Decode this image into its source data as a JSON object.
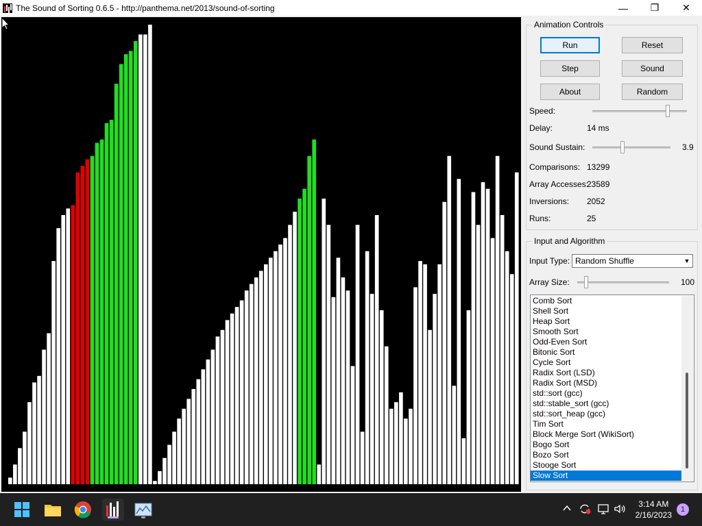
{
  "window": {
    "title": "The Sound of Sorting 0.6.5 - http://panthema.net/2013/sound-of-sorting",
    "minimize_label": "—",
    "maximize_label": "❐",
    "close_label": "✕"
  },
  "visualization": {
    "bar_values": [
      2,
      6,
      11,
      16,
      25,
      31,
      33,
      41,
      46,
      68,
      78,
      82,
      84,
      85,
      95,
      97,
      99,
      100,
      104,
      105,
      110,
      111,
      122,
      128,
      131,
      132,
      135,
      137,
      137,
      140,
      1,
      4,
      8,
      12,
      16,
      20,
      23,
      26,
      29,
      32,
      35,
      38,
      41,
      45,
      47,
      50,
      52,
      54,
      56,
      59,
      61,
      63,
      65,
      67,
      69,
      71,
      73,
      75,
      79,
      83,
      87,
      90,
      100,
      105,
      6,
      87,
      79,
      57,
      69,
      63,
      59,
      36,
      79,
      16,
      71,
      58,
      82,
      53,
      42,
      23,
      25,
      28,
      20,
      23,
      60,
      68,
      67,
      47,
      58,
      67,
      86,
      100,
      30,
      93,
      14,
      53,
      89,
      79,
      92,
      90,
      75,
      100,
      82,
      71,
      64,
      95
    ],
    "bar_colors": {
      "default": "#ffffff",
      "compare": "#e00000",
      "sorted": "#22dd22",
      "background": "#000000"
    }
  },
  "animation_controls": {
    "title": "Animation Controls",
    "buttons": {
      "run": "Run",
      "reset": "Reset",
      "step": "Step",
      "sound": "Sound",
      "about": "About",
      "random": "Random"
    },
    "speed_label": "Speed:",
    "speed_level": 0.8,
    "delay_label": "Delay:",
    "delay_value": "14 ms",
    "sustain_label": "Sound Sustain:",
    "sustain_value": "3.9",
    "sustain_level": 0.39,
    "comparisons_label": "Comparisons:",
    "comparisons_value": "13299",
    "array_accesses_label": "Array Accesses:",
    "array_accesses_value": "23589",
    "inversions_label": "Inversions:",
    "inversions_value": "2052",
    "runs_label": "Runs:",
    "runs_value": "25"
  },
  "input_algorithm": {
    "title": "Input and Algorithm",
    "input_type_label": "Input Type:",
    "input_type_value": "Random Shuffle",
    "array_size_label": "Array Size:",
    "array_size_value": "100",
    "array_size_level": 0.1,
    "algorithms": [
      "Comb Sort",
      "Shell Sort",
      "Heap Sort",
      "Smooth Sort",
      "Odd-Even Sort",
      "Bitonic Sort",
      "Cycle Sort",
      "Radix Sort (LSD)",
      "Radix Sort (MSD)",
      "std::sort (gcc)",
      "std::stable_sort (gcc)",
      "std::sort_heap (gcc)",
      "Tim Sort",
      "Block Merge Sort (WikiSort)",
      "Bogo Sort",
      "Bozo Sort",
      "Stooge Sort",
      "Slow Sort"
    ],
    "selected_index": 17
  },
  "taskbar": {
    "time": "3:14 AM",
    "date": "2/16/2023",
    "notification_count": "1",
    "apps": [
      "start-icon",
      "file-explorer-icon",
      "chrome-icon",
      "sound-of-sorting-icon",
      "network-monitor-icon"
    ]
  }
}
